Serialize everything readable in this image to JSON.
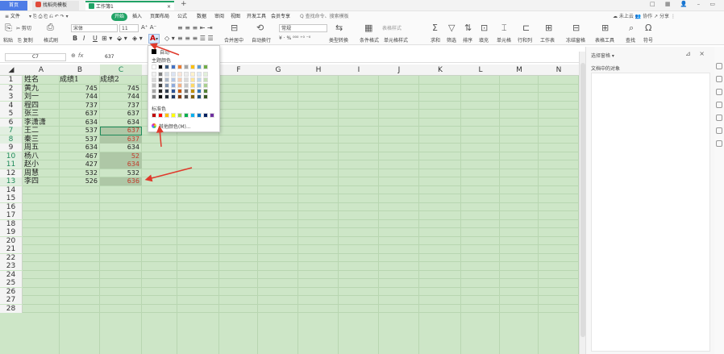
{
  "titlebar": {
    "home_tab": "首页",
    "tab1": "找稻壳模板",
    "tab2": "工作簿1",
    "add_tab": "+",
    "controls": "□ ▦ 👤 – ▭"
  },
  "menubar": {
    "file": "≡ 文件",
    "quick": "▾  ⎘ ⎙ ⎗ ⎌ ↶ ↷ ▾",
    "items": [
      "开始",
      "插入",
      "页面布局",
      "公式",
      "数据",
      "审阅",
      "视图",
      "开发工具",
      "会员专享"
    ],
    "search": "Q 查找命令、搜索模板",
    "right": "☁ 未上云  👥 协作  ↗ 分享  ⋮"
  },
  "ribbon": {
    "paste": "粘贴",
    "cut": "✂ 剪切",
    "copy": "⎘ 复制",
    "format_painter": "格式刷",
    "font_name": "宋体",
    "font_size": "11",
    "bold": "B",
    "italic": "I",
    "underline": "U",
    "font_color": "A",
    "merge": "合并居中",
    "wrap": "自动换行",
    "number_format": "常规",
    "percent": "¥ · % ⁰⁰⁰ ⁺⁰ ⁻⁰",
    "type_convert": "类型转换",
    "cond_format": "条件格式",
    "cell_style": "单元格样式",
    "sum": "求和",
    "filter": "筛选",
    "sort": "排序",
    "fill": "填充",
    "cell": "单元格",
    "row_col": "行和列",
    "sheet": "工作表",
    "freeze": "冻结窗格",
    "table_tools": "表格工具",
    "find": "查找",
    "symbol": "符号",
    "table_style": "表格样式"
  },
  "formula": {
    "namebox": "C7",
    "fx": "fx",
    "value": "637"
  },
  "columns": [
    "A",
    "B",
    "C",
    "D",
    "E",
    "F",
    "G",
    "H",
    "I",
    "J",
    "K",
    "L",
    "M",
    "N"
  ],
  "rows": [
    "1",
    "2",
    "3",
    "4",
    "5",
    "6",
    "7",
    "8",
    "9",
    "10",
    "11",
    "12",
    "13",
    "14",
    "15",
    "16",
    "17",
    "18",
    "19",
    "20",
    "21",
    "22",
    "23",
    "24",
    "25",
    "26",
    "27",
    "28"
  ],
  "table": {
    "headers": [
      "姓名",
      "成绩1",
      "成绩2"
    ],
    "data": [
      [
        "黄九",
        "745",
        "745"
      ],
      [
        "刘一",
        "744",
        "744"
      ],
      [
        "程四",
        "737",
        "737"
      ],
      [
        "张三",
        "637",
        "637"
      ],
      [
        "李潇潇",
        "634",
        "634"
      ],
      [
        "王二",
        "537",
        "637"
      ],
      [
        "秦三",
        "537",
        "637"
      ],
      [
        "周五",
        "634",
        "634"
      ],
      [
        "杨八",
        "467",
        "52"
      ],
      [
        "赵小",
        "427",
        "634"
      ],
      [
        "周慧",
        "532",
        "532"
      ],
      [
        "李四",
        "526",
        "636"
      ]
    ]
  },
  "popup": {
    "auto": "自动",
    "theme_colors": "主题颜色",
    "standard_colors": "标准色",
    "more_colors": "其他颜色(M)..."
  },
  "panel": {
    "title": "选择窗格 ▾",
    "list_title": "文档中的对象",
    "controls": "⊿ ×"
  },
  "colors": {
    "accent": "#21a366",
    "red_text": "#c23b2a",
    "grid_bg": "#cde6c7",
    "arrow": "#e0392b"
  }
}
